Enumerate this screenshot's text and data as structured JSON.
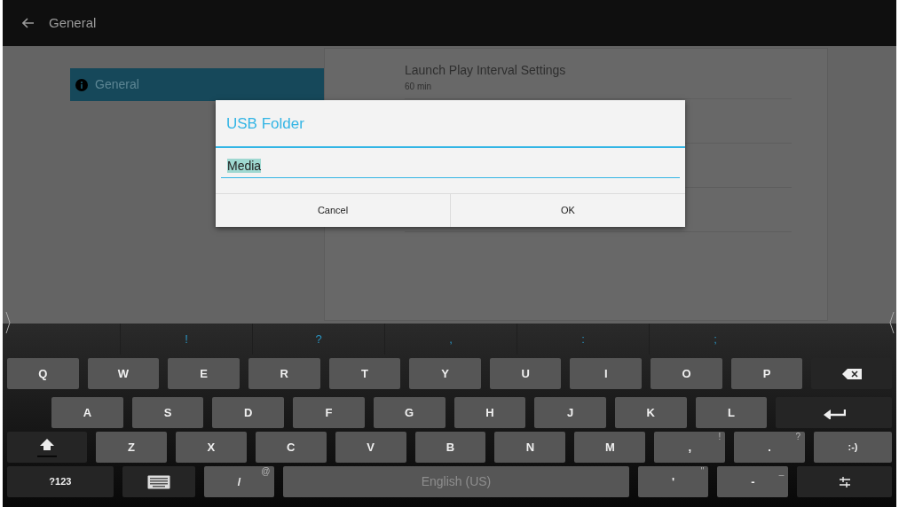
{
  "top_bar": {
    "title": "General"
  },
  "sidebar": {
    "items": [
      {
        "label": "General",
        "selected": true
      }
    ]
  },
  "settings": {
    "items": [
      {
        "title": "Launch Play Interval Settings",
        "value": "60 min"
      }
    ]
  },
  "dialog": {
    "title": "USB Folder",
    "field": {
      "value": "Media",
      "text_selected": true
    },
    "buttons": [
      "Cancel",
      "OK"
    ]
  },
  "keyboard": {
    "suggestions": [
      "!",
      "?",
      ",",
      ":",
      ";"
    ],
    "key_rows": [
      {
        "keys": [
          {
            "kind": "letter",
            "label": "Q"
          },
          {
            "kind": "letter",
            "label": "W"
          },
          {
            "kind": "letter",
            "label": "E"
          },
          {
            "kind": "letter",
            "label": "R"
          },
          {
            "kind": "letter",
            "label": "T"
          },
          {
            "kind": "letter",
            "label": "Y"
          },
          {
            "kind": "letter",
            "label": "U"
          },
          {
            "kind": "letter",
            "label": "I"
          },
          {
            "kind": "letter",
            "label": "O"
          },
          {
            "kind": "letter",
            "label": "P"
          },
          {
            "kind": "backspace"
          }
        ]
      },
      {
        "keys": [
          {
            "kind": "letter",
            "label": "A"
          },
          {
            "kind": "letter",
            "label": "S"
          },
          {
            "kind": "letter",
            "label": "D"
          },
          {
            "kind": "letter",
            "label": "F"
          },
          {
            "kind": "letter",
            "label": "G"
          },
          {
            "kind": "letter",
            "label": "H"
          },
          {
            "kind": "letter",
            "label": "J"
          },
          {
            "kind": "letter",
            "label": "K"
          },
          {
            "kind": "letter",
            "label": "L"
          },
          {
            "kind": "enter"
          }
        ]
      },
      {
        "keys": [
          {
            "kind": "shift"
          },
          {
            "kind": "letter",
            "label": "Z"
          },
          {
            "kind": "letter",
            "label": "X"
          },
          {
            "kind": "letter",
            "label": "C"
          },
          {
            "kind": "letter",
            "label": "V"
          },
          {
            "kind": "letter",
            "label": "B"
          },
          {
            "kind": "letter",
            "label": "N"
          },
          {
            "kind": "letter",
            "label": "M"
          },
          {
            "kind": "letter",
            "label": ",",
            "hint": "!"
          },
          {
            "kind": "letter",
            "label": ".",
            "hint": "?"
          },
          {
            "kind": "smiley",
            "label": ":-)"
          }
        ]
      },
      {
        "keys": [
          {
            "kind": "symbols",
            "label": "?123"
          },
          {
            "kind": "keyboard"
          },
          {
            "kind": "letter",
            "label": "/",
            "hint": "@"
          },
          {
            "kind": "space",
            "label": "English (US)"
          },
          {
            "kind": "letter",
            "label": "'",
            "hint": "\""
          },
          {
            "kind": "letter",
            "label": "-",
            "hint": "_"
          },
          {
            "kind": "settings"
          }
        ]
      }
    ]
  }
}
